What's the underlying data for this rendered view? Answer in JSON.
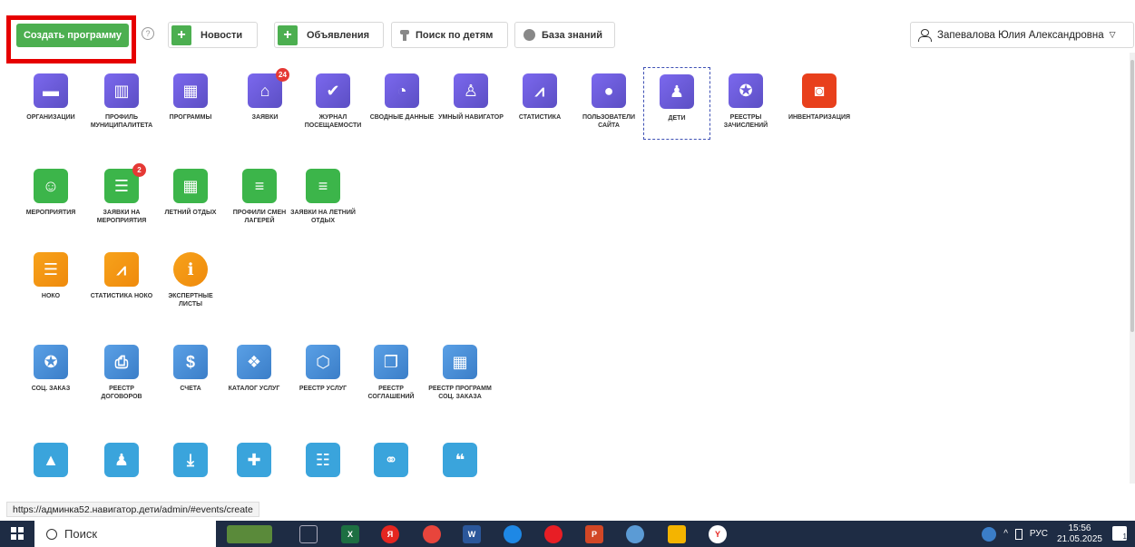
{
  "toolbar": {
    "create_label": "Создать программу",
    "help_symbol": "?",
    "news_label": "Новости",
    "ads_label": "Объявления",
    "child_search_label": "Поиск по детям",
    "knowledge_label": "База знаний",
    "plus_symbol": "+"
  },
  "user": {
    "name": "Запевалова Юлия Александровна",
    "caret": "▽"
  },
  "tiles": {
    "orgs": {
      "label": "ОРГАНИЗАЦИИ",
      "icon": "briefcase-icon",
      "glyph": "▬"
    },
    "municipality": {
      "label": "ПРОФИЛЬ МУНИЦИПАЛИТЕТА",
      "icon": "building-icon",
      "glyph": "▥"
    },
    "programs": {
      "label": "ПРОГРАММЫ",
      "icon": "calendar-icon",
      "glyph": "▦"
    },
    "applications": {
      "label": "ЗАЯВКИ",
      "icon": "basket-icon",
      "glyph": "⌂",
      "badge": "24"
    },
    "attendance": {
      "label": "ЖУРНАЛ ПОСЕЩАЕМОСТИ",
      "icon": "calendar-check-icon",
      "glyph": "✔"
    },
    "summary": {
      "label": "СВОДНЫЕ ДАННЫЕ",
      "icon": "dashboard-icon",
      "glyph": "◔"
    },
    "smart_nav": {
      "label": "УМНЫЙ НАВИГАТОР",
      "icon": "microscope-icon",
      "glyph": "♙"
    },
    "stats": {
      "label": "СТАТИСТИКА",
      "icon": "area-chart-icon",
      "glyph": "⩘"
    },
    "site_users": {
      "label": "ПОЛЬЗОВАТЕЛИ САЙТА",
      "icon": "user-icon",
      "glyph": "●"
    },
    "children": {
      "label": "ДЕТИ",
      "icon": "child-icon",
      "glyph": "♟"
    },
    "credit_registry": {
      "label": "РЕЕСТРЫ ЗАЧИСЛЕНИЙ",
      "icon": "certificate-icon",
      "glyph": "✪"
    },
    "inventory": {
      "label": "ИНВЕНТАРИЗАЦИЯ",
      "icon": "money-icon",
      "glyph": "◙"
    },
    "events": {
      "label": "МЕРОПРИЯТИЯ",
      "icon": "smile-icon",
      "glyph": "☺"
    },
    "event_apps": {
      "label": "ЗАЯВКИ НА МЕРОПРИЯТИЯ",
      "icon": "list-icon",
      "glyph": "☰",
      "badge": "2"
    },
    "summer": {
      "label": "ЛЕТНИЙ ОТДЫХ",
      "icon": "calendar-icon",
      "glyph": "▦"
    },
    "camp_profiles": {
      "label": "ПРОФИЛИ СМЕН ЛАГЕРЕЙ",
      "icon": "lines-icon",
      "glyph": "≡"
    },
    "summer_apps": {
      "label": "ЗАЯВКИ НА ЛЕТНИЙ ОТДЫХ",
      "icon": "lines-icon",
      "glyph": "≡"
    },
    "noko": {
      "label": "НОКО",
      "icon": "list-icon",
      "glyph": "☰"
    },
    "noko_stats": {
      "label": "СТАТИСТИКА НОКО",
      "icon": "area-chart-icon",
      "glyph": "⩘"
    },
    "expert": {
      "label": "ЭКСПЕРТНЫЕ ЛИСТЫ",
      "icon": "info-icon",
      "glyph": "ℹ"
    },
    "social_order": {
      "label": "СОЦ. ЗАКАЗ",
      "icon": "certificate-icon",
      "glyph": "✪"
    },
    "contracts": {
      "label": "РЕЕСТР ДОГОВОРОВ",
      "icon": "contract-icon",
      "glyph": "⎙"
    },
    "invoices": {
      "label": "СЧЕТА",
      "icon": "invoice-icon",
      "glyph": "$"
    },
    "service_catalog": {
      "label": "КАТАЛОГ УСЛУГ",
      "icon": "cubes-icon",
      "glyph": "❖"
    },
    "service_registry": {
      "label": "РЕЕСТР УСЛУГ",
      "icon": "cube-icon",
      "glyph": "⬡"
    },
    "agreements": {
      "label": "РЕЕСТР СОГЛАШЕНИЙ",
      "icon": "copy-icon",
      "glyph": "❐"
    },
    "soc_programs": {
      "label": "РЕЕСТР ПРОГРАММ СОЦ. ЗАКАЗА",
      "icon": "calendar-icon",
      "glyph": "▦"
    },
    "r5_1": {
      "icon": "graduation-cap-icon",
      "glyph": "▲"
    },
    "r5_2": {
      "icon": "child-icon",
      "glyph": "♟"
    },
    "r5_3": {
      "icon": "download-icon",
      "glyph": "⤓"
    },
    "r5_4": {
      "icon": "user-plus-icon",
      "glyph": "✚"
    },
    "r5_5": {
      "icon": "table-list-icon",
      "glyph": "☷"
    },
    "r5_6": {
      "icon": "handshake-icon",
      "glyph": "⚭"
    },
    "r5_7": {
      "icon": "comments-icon",
      "glyph": "❝"
    }
  },
  "status_url": "https://админка52.навигатор.дети/admin/#events/create",
  "taskbar": {
    "search_label": "Поиск",
    "lang": "РУС",
    "time": "15:56",
    "date": "21.05.2025",
    "tray_up": "^",
    "notifications": "1",
    "apps": {
      "excel": "X",
      "yandex": "Я",
      "word": "W",
      "ppt": "P",
      "ya_browser": "Y"
    }
  },
  "colors": {
    "purple": "#6a5acd",
    "green": "#3cb54a",
    "orange": "#f39c12",
    "red": "#e8401c",
    "blue": "#4a90d9",
    "create": "#4caf50"
  }
}
